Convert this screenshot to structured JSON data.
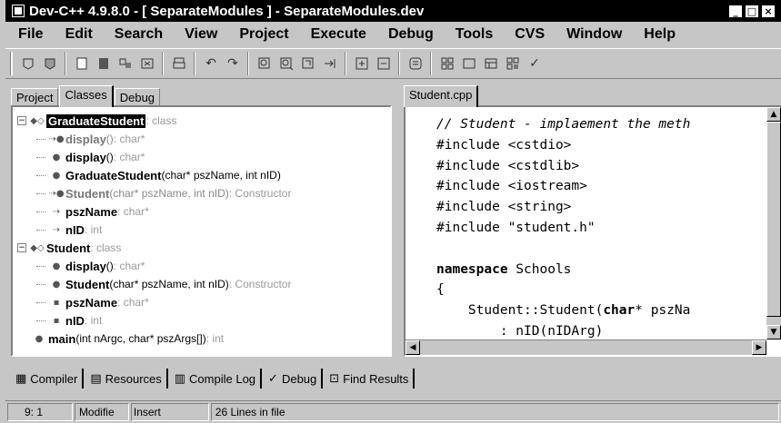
{
  "window": {
    "title": "Dev-C++ 4.9.8.0  - [ SeparateModules ] - SeparateModules.dev",
    "controls": [
      "minimize-icon",
      "maximize-icon",
      "close-icon"
    ]
  },
  "menu": [
    "File",
    "Edit",
    "Search",
    "View",
    "Project",
    "Execute",
    "Debug",
    "Tools",
    "CVS",
    "Window",
    "Help"
  ],
  "toolbar": {
    "groups": [
      [
        "new-project-icon",
        "open-project-icon"
      ],
      [
        "new-file-icon",
        "save-icon",
        "save-all-icon",
        "close-file-icon"
      ],
      [
        "print-icon"
      ],
      [
        "undo-icon",
        "redo-icon"
      ],
      [
        "find-icon",
        "find-next-icon",
        "replace-icon",
        "goto-line-icon"
      ],
      [
        "add-to-project-icon",
        "remove-from-project-icon"
      ],
      [
        "project-options-icon"
      ],
      [
        "compile-icon",
        "run-icon",
        "compile-run-icon",
        "rebuild-icon",
        "check-syntax-icon"
      ]
    ]
  },
  "left_tabs": [
    "Project",
    "Classes",
    "Debug"
  ],
  "left_active_tab": "Classes",
  "class_tree": [
    {
      "level": 0,
      "expander": "−",
      "icon": "class-icon",
      "name": "GraduateStudent",
      "signature": "",
      "hint": " : class",
      "selected": true
    },
    {
      "level": 1,
      "icon": "inherited-method-icon",
      "name": "display",
      "signature": " () ",
      "hint": ": char*",
      "gray": true
    },
    {
      "level": 1,
      "icon": "public-method-icon",
      "name": "display",
      "signature": " () ",
      "hint": ": char*"
    },
    {
      "level": 1,
      "icon": "public-method-icon",
      "name": "GraduateStudent",
      "signature": " (char* pszName, int nID)",
      "hint": ""
    },
    {
      "level": 1,
      "icon": "inherited-method-icon",
      "name": "Student",
      "signature": " (char* pszName, int nID)",
      "hint": " : Constructor",
      "gray": true
    },
    {
      "level": 1,
      "icon": "protected-inherited-field-icon",
      "name": "pszName",
      "signature": "",
      "hint": " : char*"
    },
    {
      "level": 1,
      "icon": "protected-inherited-field-icon",
      "name": "nID",
      "signature": "",
      "hint": " : int"
    },
    {
      "level": 0,
      "expander": "−",
      "icon": "class-icon",
      "name": "Student",
      "signature": "",
      "hint": " : class"
    },
    {
      "level": 1,
      "icon": "public-method-icon",
      "name": "display",
      "signature": " () ",
      "hint": ": char*"
    },
    {
      "level": 1,
      "icon": "public-method-icon",
      "name": "Student",
      "signature": " (char* pszName, int nID)",
      "hint": " : Constructor"
    },
    {
      "level": 1,
      "icon": "protected-field-icon",
      "name": "pszName",
      "signature": "",
      "hint": " : char*"
    },
    {
      "level": 1,
      "icon": "protected-field-icon",
      "name": "nID",
      "signature": "",
      "hint": " : int"
    },
    {
      "level": 0,
      "icon": "function-icon",
      "name": "main",
      "signature": " (int nArgc, char* pszArgs[])",
      "hint": " : int"
    }
  ],
  "editor": {
    "tab": "Student.cpp",
    "lines": [
      {
        "parts": [
          {
            "t": "// Student - implaement the meth",
            "c": "cm"
          }
        ]
      },
      {
        "parts": [
          {
            "t": "#include <cstdio>"
          }
        ]
      },
      {
        "parts": [
          {
            "t": "#include <cstdlib>"
          }
        ]
      },
      {
        "parts": [
          {
            "t": "#include <iostream>"
          }
        ]
      },
      {
        "parts": [
          {
            "t": "#include <string>"
          }
        ]
      },
      {
        "parts": [
          {
            "t": "#include \"student.h\""
          }
        ]
      },
      {
        "parts": [
          {
            "t": ""
          }
        ]
      },
      {
        "parts": [
          {
            "t": "namespace",
            "c": "kw"
          },
          {
            "t": " Schools"
          }
        ]
      },
      {
        "parts": [
          {
            "t": "{"
          }
        ]
      },
      {
        "parts": [
          {
            "t": "    Student::Student("
          },
          {
            "t": "char",
            "c": "kw"
          },
          {
            "t": "* pszNa"
          }
        ]
      },
      {
        "parts": [
          {
            "t": "        : nID(nIDArg)"
          }
        ]
      }
    ]
  },
  "bottom_tabs": [
    {
      "icon": "compiler-icon",
      "label": "Compiler"
    },
    {
      "icon": "resources-icon",
      "label": "Resources"
    },
    {
      "icon": "compile-log-icon",
      "label": "Compile Log"
    },
    {
      "icon": "debug-check-icon",
      "label": "Debug"
    },
    {
      "icon": "find-results-icon",
      "label": "Find Results"
    }
  ],
  "status": {
    "position": "9: 1",
    "modified": "Modifie",
    "mode": "Insert",
    "lines_info": "26 Lines in file"
  }
}
